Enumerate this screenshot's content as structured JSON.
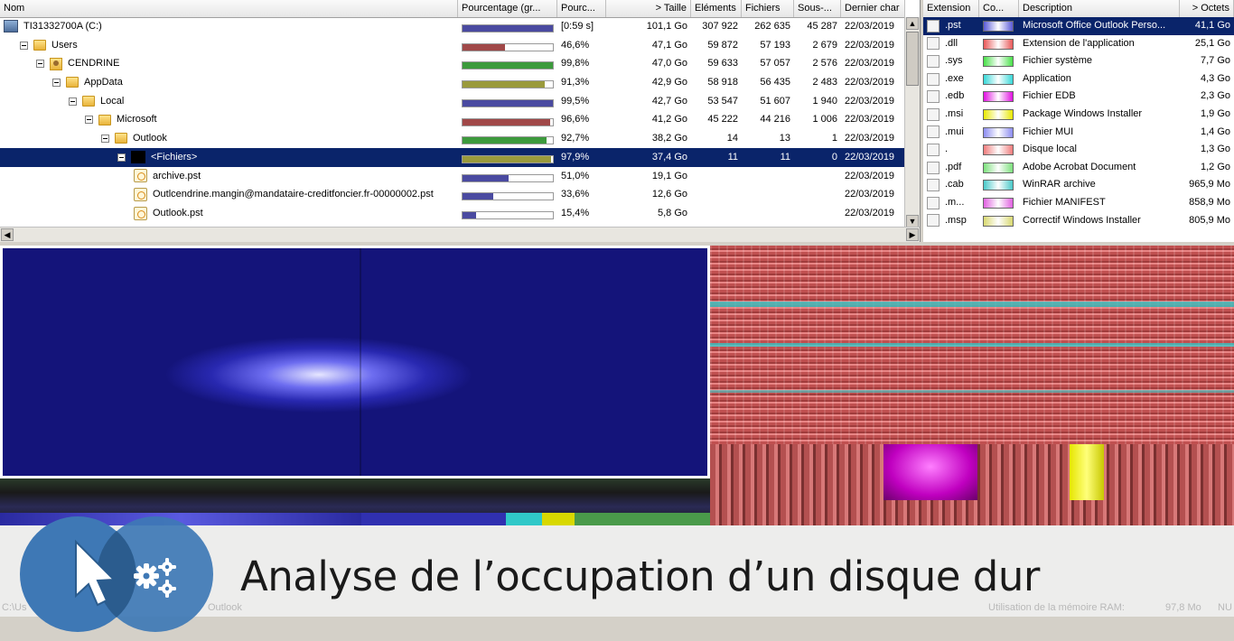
{
  "tree": {
    "columns": [
      "Nom",
      "Pourcentage (gr...",
      "Pourc...",
      "> Taille",
      "Eléments",
      "Fichiers",
      "Sous-...",
      "Dernier char"
    ],
    "rows": [
      {
        "name": "TI31332700A (C:)",
        "icon": "drive-icon",
        "level": 0,
        "pct_bar": 1.0,
        "bar_color": "#4a4aa0",
        "pct": "[0:59 s]",
        "size": "101,1 Go",
        "items": "307 922",
        "files": "262 635",
        "subdirs": "45 287",
        "date": "22/03/2019"
      },
      {
        "name": "Users",
        "icon": "folder-icon",
        "level": 1,
        "pct_bar": 0.466,
        "bar_color": "#a04848",
        "pct": "46,6%",
        "size": "47,1 Go",
        "items": "59 872",
        "files": "57 193",
        "subdirs": "2 679",
        "date": "22/03/2019"
      },
      {
        "name": "CENDRINE",
        "icon": "user-folder-icon",
        "level": 2,
        "pct_bar": 0.998,
        "bar_color": "#3c9a3c",
        "pct": "99,8%",
        "size": "47,0 Go",
        "items": "59 633",
        "files": "57 057",
        "subdirs": "2 576",
        "date": "22/03/2019"
      },
      {
        "name": "AppData",
        "icon": "folder-icon",
        "level": 3,
        "pct_bar": 0.913,
        "bar_color": "#9a9a3c",
        "pct": "91,3%",
        "size": "42,9 Go",
        "items": "58 918",
        "files": "56 435",
        "subdirs": "2 483",
        "date": "22/03/2019"
      },
      {
        "name": "Local",
        "icon": "folder-icon",
        "level": 4,
        "pct_bar": 0.995,
        "bar_color": "#4a4aa0",
        "pct": "99,5%",
        "size": "42,7 Go",
        "items": "53 547",
        "files": "51 607",
        "subdirs": "1 940",
        "date": "22/03/2019"
      },
      {
        "name": "Microsoft",
        "icon": "folder-icon",
        "level": 5,
        "pct_bar": 0.966,
        "bar_color": "#a04848",
        "pct": "96,6%",
        "size": "41,2 Go",
        "items": "45 222",
        "files": "44 216",
        "subdirs": "1 006",
        "date": "22/03/2019"
      },
      {
        "name": "Outlook",
        "icon": "folder-icon",
        "level": 6,
        "pct_bar": 0.927,
        "bar_color": "#3c9a3c",
        "pct": "92,7%",
        "size": "38,2 Go",
        "items": "14",
        "files": "13",
        "subdirs": "1",
        "date": "22/03/2019"
      },
      {
        "name": "<Fichiers>",
        "icon": "files-group-icon",
        "level": 7,
        "pct_bar": 0.979,
        "bar_color": "#9a9a3c",
        "pct": "97,9%",
        "size": "37,4 Go",
        "items": "11",
        "files": "11",
        "subdirs": "0",
        "date": "22/03/2019",
        "selected": true
      },
      {
        "name": "archive.pst",
        "icon": "pst-file-icon",
        "level": 8,
        "pct_bar": 0.51,
        "bar_color": "#4a4aa0",
        "pct": "51,0%",
        "size": "19,1 Go",
        "items": "",
        "files": "",
        "subdirs": "",
        "date": "22/03/2019"
      },
      {
        "name": "Outlcendrine.mangin@mandataire-creditfoncier.fr-00000002.pst",
        "icon": "pst-file-icon",
        "level": 8,
        "pct_bar": 0.336,
        "bar_color": "#4a4aa0",
        "pct": "33,6%",
        "size": "12,6 Go",
        "items": "",
        "files": "",
        "subdirs": "",
        "date": "22/03/2019"
      },
      {
        "name": "Outlook.pst",
        "icon": "pst-file-icon",
        "level": 8,
        "pct_bar": 0.154,
        "bar_color": "#4a4aa0",
        "pct": "15,4%",
        "size": "5,8 Go",
        "items": "",
        "files": "",
        "subdirs": "",
        "date": "22/03/2019"
      }
    ]
  },
  "extensions": {
    "columns": [
      "Extension",
      "Co...",
      "Description",
      "> Octets"
    ],
    "rows": [
      {
        "ext": ".pst",
        "color": "#5a5ad8",
        "desc": "Microsoft Office Outlook Perso...",
        "bytes": "41,1 Go",
        "selected": true
      },
      {
        "ext": ".dll",
        "color": "#e85858",
        "desc": "Extension de l'application",
        "bytes": "25,1 Go"
      },
      {
        "ext": ".sys",
        "color": "#48e048",
        "desc": "Fichier système",
        "bytes": "7,7 Go"
      },
      {
        "ext": ".exe",
        "color": "#38d8d8",
        "desc": "Application",
        "bytes": "4,3 Go"
      },
      {
        "ext": ".edb",
        "color": "#e010e0",
        "desc": "Fichier EDB",
        "bytes": "2,3 Go"
      },
      {
        "ext": ".msi",
        "color": "#e8e800",
        "desc": "Package Windows Installer",
        "bytes": "1,9 Go"
      },
      {
        "ext": ".mui",
        "color": "#8c8cf0",
        "desc": "Fichier MUI",
        "bytes": "1,4 Go"
      },
      {
        "ext": ".",
        "color": "#f07c7c",
        "desc": "Disque local",
        "bytes": "1,3 Go"
      },
      {
        "ext": ".pdf",
        "color": "#7ce07c",
        "desc": "Adobe Acrobat Document",
        "bytes": "1,2 Go"
      },
      {
        "ext": ".cab",
        "color": "#48c8c8",
        "desc": "WinRAR archive",
        "bytes": "965,9 Mo"
      },
      {
        "ext": ".m...",
        "color": "#e060e0",
        "desc": "Fichier MANIFEST",
        "bytes": "858,9 Mo"
      },
      {
        "ext": ".msp",
        "color": "#d8d870",
        "desc": "Correctif Windows Installer",
        "bytes": "805,9 Mo"
      }
    ]
  },
  "status": {
    "path": "C:\\Us",
    "path_tail": "Outlook",
    "memory": "Utilisation de la mémoire RAM:",
    "memory_value": "97,8 Mo",
    "num": "NU"
  },
  "banner": {
    "title": "Analyse de l’occupation d’un disque dur"
  }
}
